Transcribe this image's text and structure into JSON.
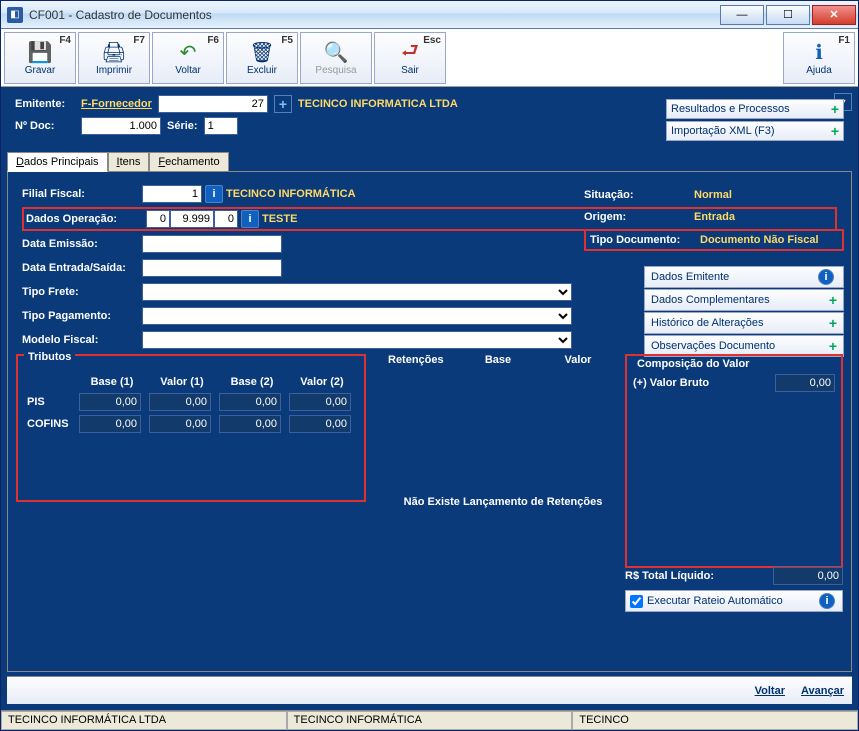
{
  "window": {
    "title": "CF001 - Cadastro de Documentos"
  },
  "toolbar": {
    "gravar": {
      "label": "Gravar",
      "key": "F4"
    },
    "imprimir": {
      "label": "Imprimir",
      "key": "F7"
    },
    "voltar": {
      "label": "Voltar",
      "key": "F6"
    },
    "excluir": {
      "label": "Excluir",
      "key": "F5"
    },
    "pesquisa": {
      "label": "Pesquisa"
    },
    "sair": {
      "label": "Sair",
      "key": "Esc"
    },
    "ajuda": {
      "label": "Ajuda",
      "key": "F1"
    }
  },
  "header": {
    "emitente_label": "Emitente:",
    "emitente_link": "F-Fornecedor",
    "emitente_code": "27",
    "emitente_name": "TECINCO INFORMATICA LTDA",
    "ndoc_label": "Nº Doc:",
    "ndoc_value": "1.000",
    "serie_label": "Série:",
    "serie_value": "1"
  },
  "side": {
    "resultados": "Resultados e Processos",
    "importacao": "Importação XML (F3)"
  },
  "tabs": {
    "t1": "Dados Principais",
    "t2": "Itens",
    "t3": "Fechamento"
  },
  "form": {
    "filial_label": "Filial Fiscal:",
    "filial_value": "1",
    "filial_name": "TECINCO INFORMÁTICA",
    "dados_op_label": "Dados Operação:",
    "dados_op_v1": "0",
    "dados_op_v2": "9.999",
    "dados_op_v3": "0",
    "dados_op_name": "TESTE",
    "data_emissao_label": "Data Emissão:",
    "data_entrada_label": "Data Entrada/Saída:",
    "tipo_frete_label": "Tipo Frete:",
    "tipo_pag_label": "Tipo Pagamento:",
    "modelo_label": "Modelo Fiscal:"
  },
  "right": {
    "situacao_l": "Situação:",
    "situacao_v": "Normal",
    "origem_l": "Origem:",
    "origem_v": "Entrada",
    "tipodoc_l": "Tipo Documento:",
    "tipodoc_v": "Documento Não Fiscal"
  },
  "midbtns": {
    "dados_emitente": "Dados Emitente",
    "dados_compl": "Dados Complementares",
    "historico": "Histórico de Alterações",
    "observacoes": "Observações Documento"
  },
  "tributos": {
    "title": "Tributos",
    "h_base1": "Base (1)",
    "h_valor1": "Valor (1)",
    "h_base2": "Base (2)",
    "h_valor2": "Valor (2)",
    "rows": [
      {
        "name": "PIS",
        "b1": "0,00",
        "v1": "0,00",
        "b2": "0,00",
        "v2": "0,00"
      },
      {
        "name": "COFINS",
        "b1": "0,00",
        "v1": "0,00",
        "b2": "0,00",
        "v2": "0,00"
      }
    ]
  },
  "retencoes": {
    "title": "Retenções",
    "base": "Base",
    "valor": "Valor",
    "empty": "Não Existe Lançamento de Retenções"
  },
  "composicao": {
    "title": "Composição do Valor",
    "bruto_l": "(+) Valor Bruto",
    "bruto_v": "0,00",
    "total_l": "R$ Total Líquido:",
    "total_v": "0,00",
    "rateio": "Executar Rateio Automático"
  },
  "nav": {
    "voltar": "Voltar",
    "avancar": "Avançar"
  },
  "status": {
    "c1": "TECINCO INFORMÁTICA LTDA",
    "c2": "TECINCO INFORMÁTICA",
    "c3": "TECINCO"
  }
}
